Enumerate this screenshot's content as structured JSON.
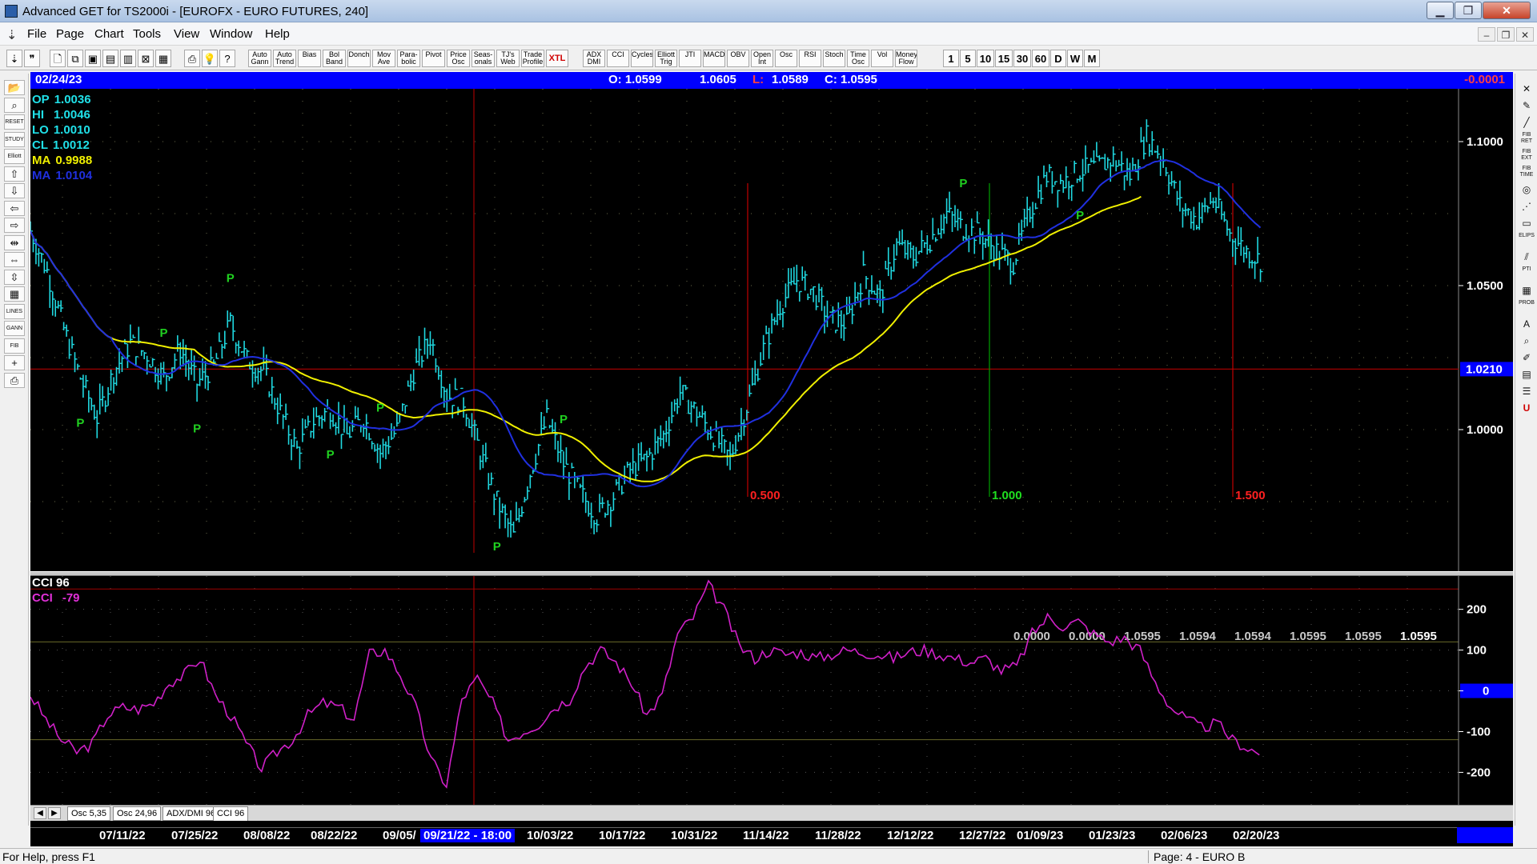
{
  "window": {
    "title": "Advanced GET for TS2000i - [EUROFX - EURO FUTURES, 240]",
    "min_glyph": "▁",
    "max_glyph": "❐",
    "close_glyph": "✕"
  },
  "menu": {
    "items": [
      "File",
      "Page",
      "Chart",
      "Tools",
      "View",
      "Window",
      "Help"
    ],
    "mdi_min": "–",
    "mdi_restore": "❐",
    "mdi_close": "✕"
  },
  "toolbar": {
    "study_buttons": [
      [
        "Auto",
        "Gann"
      ],
      [
        "Auto",
        "Trend"
      ],
      [
        "Bias",
        ""
      ],
      [
        "Bol",
        "Band"
      ],
      [
        "Donch",
        ""
      ],
      [
        "Mov",
        "Ave"
      ],
      [
        "Para-",
        "bolic"
      ],
      [
        "Pivot",
        ""
      ],
      [
        "Price",
        "Osc"
      ],
      [
        "Seas-",
        "onals"
      ],
      [
        "TJ's",
        "Web"
      ],
      [
        "Trade",
        "Profile"
      ]
    ],
    "xtl_label": "XTL",
    "osc_buttons": [
      [
        "ADX",
        "DMI"
      ],
      [
        "CCI",
        ""
      ],
      [
        "Cycles",
        ""
      ],
      [
        "Elliott",
        "Trig"
      ],
      [
        "JTI",
        ""
      ],
      [
        "MACD",
        ""
      ],
      [
        "OBV",
        ""
      ],
      [
        "Open",
        "Int"
      ],
      [
        "Osc",
        ""
      ],
      [
        "RSI",
        ""
      ],
      [
        "Stoch",
        ""
      ],
      [
        "Time",
        "Osc"
      ],
      [
        "Vol",
        ""
      ],
      [
        "Money",
        "Flow"
      ]
    ],
    "interval_buttons": [
      "1",
      "5",
      "10",
      "15",
      "30",
      "60",
      "D",
      "W",
      "M"
    ]
  },
  "left_tools": [
    {
      "icon": "folder-icon",
      "glyph": "📂"
    },
    {
      "icon": "binoculars-icon",
      "glyph": "⌕"
    },
    {
      "icon": "reset-icon",
      "glyph": "RESET"
    },
    {
      "icon": "study-icon",
      "glyph": "STUDY"
    },
    {
      "icon": "elliott-icon",
      "glyph": "Elliott"
    },
    {
      "icon": "arrow-up-icon",
      "glyph": "⇧"
    },
    {
      "icon": "arrow-down-icon",
      "glyph": "⇩"
    },
    {
      "icon": "arrow-left-icon",
      "glyph": "⇦"
    },
    {
      "icon": "arrow-right-icon",
      "glyph": "⇨"
    },
    {
      "icon": "compress-h-icon",
      "glyph": "⇹"
    },
    {
      "icon": "expand-h-icon",
      "glyph": "⇔"
    },
    {
      "icon": "compress-v-icon",
      "glyph": "⇳"
    },
    {
      "icon": "grid-icon",
      "glyph": "▦"
    },
    {
      "icon": "lines-icon",
      "glyph": "LINES"
    },
    {
      "icon": "gann-icon",
      "glyph": "GANN"
    },
    {
      "icon": "fib-icon",
      "glyph": "FIB"
    },
    {
      "icon": "crosshair-icon",
      "glyph": "+"
    },
    {
      "icon": "print-icon",
      "glyph": "⎙"
    }
  ],
  "right_tools": [
    {
      "icon": "close-x-icon",
      "glyph": "✕"
    },
    {
      "icon": "pencil-icon",
      "glyph": "✎"
    },
    {
      "icon": "line-tool-icon",
      "glyph": "╱"
    },
    {
      "icon": "fib-ret-icon",
      "glyph": "FIB RET"
    },
    {
      "icon": "fib-ext-icon",
      "glyph": "FIB EXT"
    },
    {
      "icon": "fib-time-icon",
      "glyph": "FIB TIME"
    },
    {
      "icon": "arc-icon",
      "glyph": "◎"
    },
    {
      "icon": "fan-icon",
      "glyph": "⋰"
    },
    {
      "icon": "box-icon",
      "glyph": "▭"
    },
    {
      "icon": "ellipse-icon",
      "glyph": "ELIPS"
    },
    {
      "icon": "channel-icon",
      "glyph": "⫽"
    },
    {
      "icon": "pti-icon",
      "glyph": "PTI"
    },
    {
      "icon": "table-icon",
      "glyph": "▦"
    },
    {
      "icon": "prob-icon",
      "glyph": "PROB"
    },
    {
      "icon": "text-icon",
      "glyph": "A"
    },
    {
      "icon": "zoom-icon",
      "glyph": "⌕"
    },
    {
      "icon": "marker-icon",
      "glyph": "✐"
    },
    {
      "icon": "calendar-icon",
      "glyph": "▤"
    },
    {
      "icon": "layers-icon",
      "glyph": "☰"
    },
    {
      "icon": "magnet-icon",
      "glyph": "U"
    }
  ],
  "info_bar": {
    "date": "02/24/23",
    "open": "O: 1.0599",
    "high": "1.0605",
    "low_label": "L:",
    "low": "1.0589",
    "close": "C: 1.0595",
    "change": "-0.0001"
  },
  "legend": {
    "op": {
      "label": "OP",
      "value": "1.0036"
    },
    "hi": {
      "label": "HI",
      "value": "1.0046"
    },
    "lo": {
      "label": "LO",
      "value": "1.0010"
    },
    "cl": {
      "label": "CL",
      "value": "1.0012"
    },
    "ma1": {
      "label": "MA",
      "value": "0.9988"
    },
    "ma2": {
      "label": "MA",
      "value": "1.0104"
    }
  },
  "price_axis": {
    "ticks": [
      "1.1000",
      "1.0500",
      "1.0000"
    ],
    "cursor_price": "1.0210"
  },
  "fib_labels": [
    "0.500",
    "1.000",
    "1.500"
  ],
  "pivot_label": "P",
  "price_readout": [
    "0.0000",
    "0.0000",
    "1.0595",
    "1.0594",
    "1.0594",
    "1.0595",
    "1.0595",
    "1.0595"
  ],
  "cci": {
    "name": "CCI 96",
    "label": "CCI",
    "value": "-79",
    "ticks": [
      "200",
      "100",
      "0",
      "-100",
      "-200"
    ]
  },
  "tabs": [
    "Osc 5,35",
    "Osc 24,96",
    "ADX/DMI 96",
    "CCI 96"
  ],
  "date_axis": {
    "labels": [
      "07/11/22",
      "07/25/22",
      "08/08/22",
      "08/22/22",
      "09/05/",
      "10/03/22",
      "10/17/22",
      "10/31/22",
      "11/14/22",
      "11/28/22",
      "12/12/22",
      "12/27/22",
      "01/09/23",
      "01/23/23",
      "02/06/23",
      "02/20/23"
    ],
    "cursor": "09/21/22 - 18:00"
  },
  "status": {
    "help": "For Help, press F1",
    "page": "Page: 4 - EURO B"
  },
  "colors": {
    "bars": "#1fd8e0",
    "ma_fast": "#2030e0",
    "ma_slow": "#f0f000",
    "cci_line": "#d020c8",
    "fib_red": "#c00000",
    "fib_green": "#00a000",
    "pivot_green": "#20d020",
    "info_bar": "#0000ff",
    "gridline": "#6a6a4a"
  },
  "chart_data": {
    "type": "ohlc",
    "series": [
      {
        "name": "EUROFX",
        "y": [
          1.069,
          1.055,
          1.035,
          1.018,
          1.004,
          1.02,
          1.03,
          1.026,
          1.018,
          1.028,
          1.016,
          1.022,
          1.037,
          1.024,
          1.02,
          1.006,
          0.993,
          1.003,
          1.007,
          0.998,
          1.004,
          0.992,
          1.0,
          1.02,
          1.032,
          1.012,
          1.01,
          0.992,
          0.975,
          0.963,
          0.985,
          1.004,
          0.988,
          0.978,
          0.97,
          0.977,
          0.986,
          0.99,
          0.998,
          1.013,
          1.006,
          0.998,
          0.99,
          1.008,
          1.028,
          1.043,
          1.052,
          1.048,
          1.038,
          1.037,
          1.054,
          1.046,
          1.064,
          1.06,
          1.066,
          1.075,
          1.07,
          1.068,
          1.062,
          1.058,
          1.076,
          1.088,
          1.086,
          1.09,
          1.091,
          1.094,
          1.088,
          1.102,
          1.094,
          1.078,
          1.073,
          1.08,
          1.068,
          1.062,
          1.058
        ]
      },
      {
        "name": "MA",
        "y": [
          0.9988
        ]
      },
      {
        "name": "MA",
        "y": [
          1.0104
        ]
      }
    ],
    "cci": [
      -10,
      -70,
      -120,
      -150,
      -130,
      -60,
      -40,
      -45,
      -30,
      20,
      40,
      80,
      -10,
      -60,
      -130,
      -190,
      -150,
      -120,
      -60,
      -30,
      -40,
      -70,
      90,
      100,
      40,
      -40,
      -170,
      -230,
      -20,
      30,
      -30,
      -120,
      -100,
      -80,
      -40,
      -20,
      60,
      100,
      70,
      20,
      -60,
      -10,
      140,
      180,
      260,
      200,
      110,
      80,
      100,
      90,
      95,
      80,
      90,
      100,
      95,
      90,
      80,
      95,
      100,
      90,
      80,
      70,
      80,
      50,
      60,
      140,
      180,
      160,
      170,
      140,
      120,
      130,
      100,
      20,
      -40,
      -70,
      -90,
      -80,
      -120,
      -140,
      -160
    ],
    "ylim": [
      0.96,
      1.11
    ],
    "cci_ylim": [
      -260,
      270
    ],
    "pivots": [
      {
        "i": 3,
        "kind": "low"
      },
      {
        "i": 8,
        "kind": "high"
      },
      {
        "i": 10,
        "kind": "low"
      },
      {
        "i": 12,
        "kind": "high"
      },
      {
        "i": 18,
        "kind": "low"
      },
      {
        "i": 21,
        "kind": "high"
      },
      {
        "i": 28,
        "kind": "low"
      },
      {
        "i": 32,
        "kind": "high"
      },
      {
        "i": 56,
        "kind": "high"
      },
      {
        "i": 63,
        "kind": "low"
      }
    ]
  }
}
